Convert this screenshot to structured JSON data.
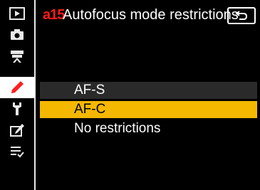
{
  "menu": {
    "code": "a15",
    "title": "Autofocus mode restrictions"
  },
  "sidebar": {
    "tabs": [
      {
        "icon": "playback-icon",
        "active": false
      },
      {
        "icon": "camera-icon",
        "active": false
      },
      {
        "icon": "movie-icon",
        "active": false
      },
      {
        "icon": "pencil-icon",
        "active": true
      },
      {
        "icon": "wrench-icon",
        "active": false
      },
      {
        "icon": "retouch-icon",
        "active": false
      },
      {
        "icon": "my-menu-icon",
        "active": false
      }
    ]
  },
  "back_button": {
    "icon": "back-arrow-icon"
  },
  "options": [
    {
      "label": "AF-S",
      "selected": false
    },
    {
      "label": "AF-C",
      "selected": true
    },
    {
      "label": "No restrictions",
      "selected": false
    }
  ],
  "colors": {
    "accent": "#f5b800",
    "code": "#ff1a1a",
    "active_icon": "#ff2020"
  }
}
